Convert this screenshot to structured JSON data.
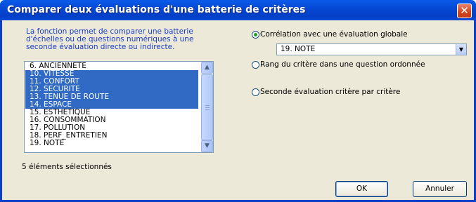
{
  "window": {
    "title": "Comparer deux évaluations d'une batterie de critères",
    "close_glyph": "✕"
  },
  "description": [
    "La fonction permet de comparer une batterie",
    "d'échelles ou de questions numériques à une",
    "seconde évaluation directe ou indirecte."
  ],
  "list": {
    "items": [
      {
        "label": "6. ANCIENNETE",
        "selected": false
      },
      {
        "label": "10. VITESSE",
        "selected": true
      },
      {
        "label": "11. CONFORT",
        "selected": true
      },
      {
        "label": "12. SECURITE",
        "selected": true
      },
      {
        "label": "13. TENUE DE ROUTE",
        "selected": true
      },
      {
        "label": "14. ESPACE",
        "selected": true
      },
      {
        "label": "15. ESTHETIQUE",
        "selected": false
      },
      {
        "label": "16. CONSOMMATION",
        "selected": false
      },
      {
        "label": "17. POLLUTION",
        "selected": false
      },
      {
        "label": "18. PERF_ENTRETIEN",
        "selected": false
      },
      {
        "label": "19. NOTE",
        "selected": false
      }
    ],
    "selection_color": "#316ac5"
  },
  "status": "5 éléments sélectionnés",
  "options": [
    {
      "label": "Corrélation avec une évaluation globale",
      "checked": true
    },
    {
      "label": "Rang du critère dans une question ordonnée",
      "checked": false
    },
    {
      "label": "Seconde évaluation critère par critère",
      "checked": false
    }
  ],
  "select": {
    "value": "19. NOTE"
  },
  "buttons": {
    "ok": "OK",
    "cancel": "Annuler"
  },
  "colors": {
    "title_bar": "#0547d4",
    "dialog_bg": "#ece9d8",
    "description_text": "#1a3cc7"
  }
}
